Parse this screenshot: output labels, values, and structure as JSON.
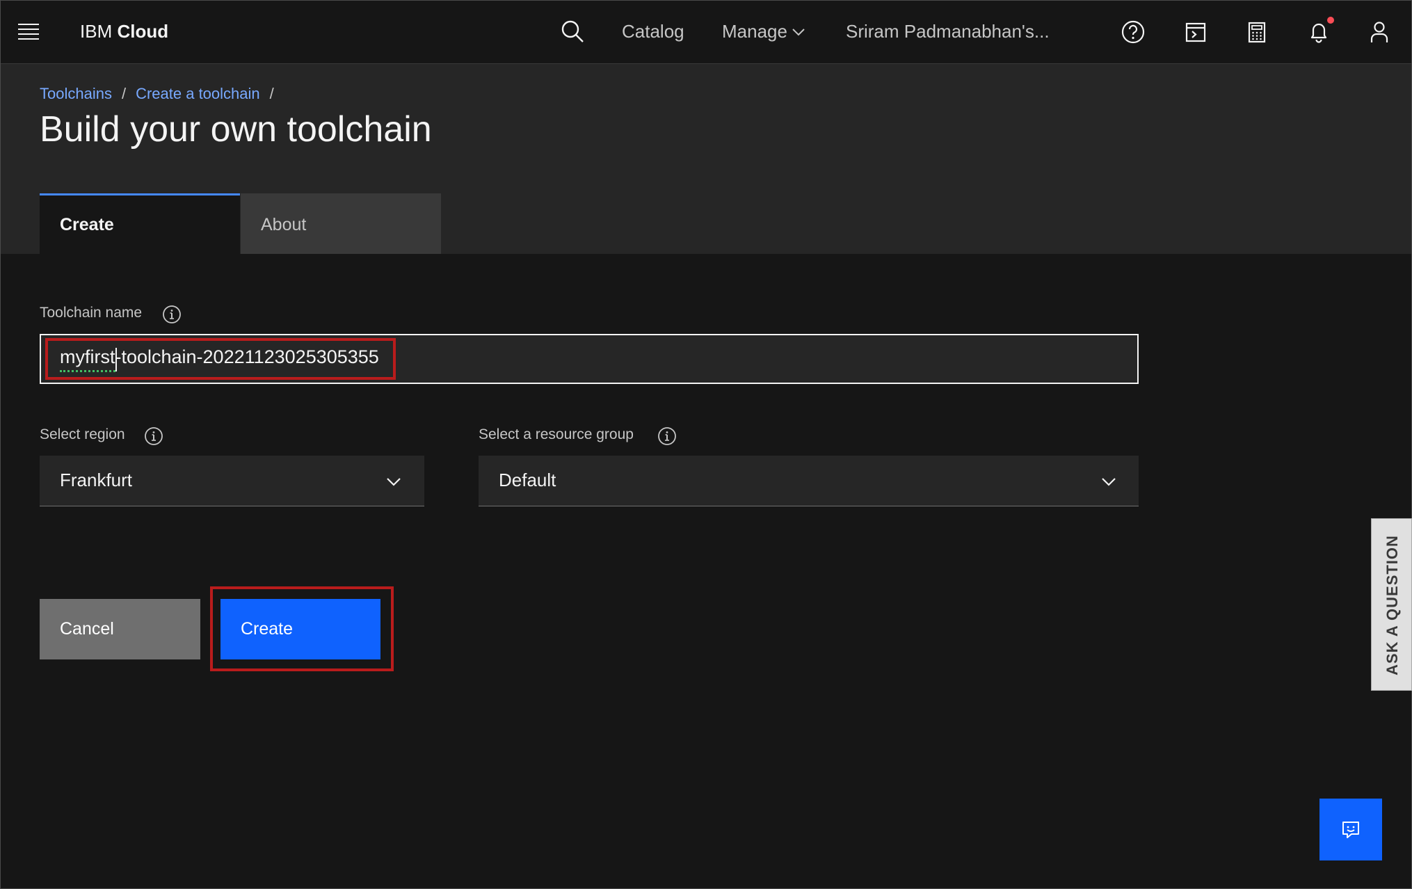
{
  "header": {
    "brand_prefix": "IBM",
    "brand_name": "Cloud",
    "nav": {
      "catalog": "Catalog",
      "manage": "Manage",
      "account": "Sriram Padmanabhan's..."
    },
    "icons": [
      "menu-icon",
      "search-icon",
      "help-icon",
      "cloud-shell-icon",
      "cost-estimator-icon",
      "notification-icon",
      "user-avatar-icon"
    ],
    "notification_dot_color": "#fa4d56"
  },
  "breadcrumb": {
    "items": [
      "Toolchains",
      "Create a toolchain"
    ],
    "separator": "/"
  },
  "page": {
    "title": "Build your own toolchain"
  },
  "tabs": [
    {
      "label": "Create",
      "selected": true
    },
    {
      "label": "About",
      "selected": false
    }
  ],
  "form": {
    "toolchain_name": {
      "label": "Toolchain name",
      "value": "myfirst-toolchain-20221123025305355"
    },
    "region": {
      "label": "Select region",
      "value": "Frankfurt"
    },
    "resource_group": {
      "label": "Select a resource group",
      "value": "Default"
    }
  },
  "actions": {
    "cancel": "Cancel",
    "create": "Create"
  },
  "side_tab": {
    "label": "ASK A QUESTION"
  },
  "colors": {
    "background": "#161616",
    "header_panel": "#262626",
    "primary_blue": "#0f62fe",
    "link_blue": "#78a9ff",
    "highlight_red": "#b91c1c"
  }
}
